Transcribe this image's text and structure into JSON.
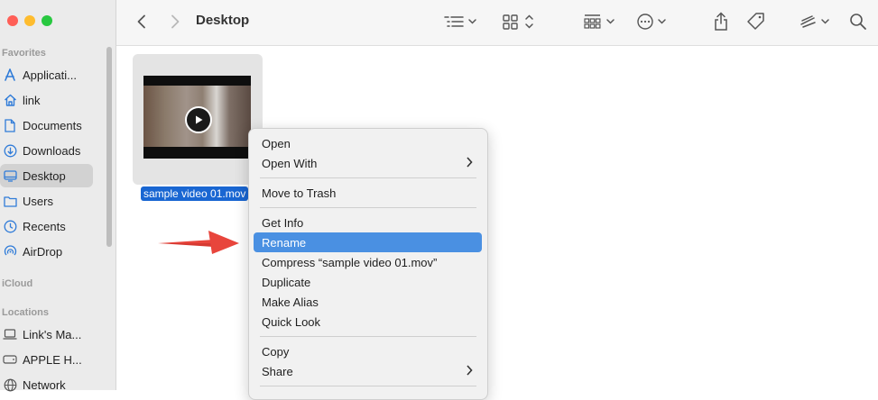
{
  "window": {
    "title": "Desktop"
  },
  "sidebar": {
    "sections": {
      "favorites": "Favorites",
      "icloud": "iCloud",
      "locations": "Locations"
    },
    "items": [
      {
        "label": "Applicati...",
        "icon": "applications-icon"
      },
      {
        "label": "link",
        "icon": "home-icon"
      },
      {
        "label": "Documents",
        "icon": "document-icon"
      },
      {
        "label": "Downloads",
        "icon": "download-icon"
      },
      {
        "label": "Desktop",
        "icon": "desktop-icon",
        "selected": true
      },
      {
        "label": "Users",
        "icon": "folder-icon"
      },
      {
        "label": "Recents",
        "icon": "clock-icon"
      },
      {
        "label": "AirDrop",
        "icon": "airdrop-icon"
      }
    ],
    "locations": [
      {
        "label": "Link's Ma...",
        "icon": "laptop-icon"
      },
      {
        "label": "APPLE H...",
        "icon": "drive-icon"
      },
      {
        "label": "Network",
        "icon": "network-icon"
      }
    ]
  },
  "file": {
    "name": "sample video 01.mov"
  },
  "context_menu": {
    "items": [
      {
        "label": "Open"
      },
      {
        "label": "Open With",
        "submenu": true
      },
      {
        "label": "Move to Trash"
      },
      {
        "label": "Get Info"
      },
      {
        "label": "Rename",
        "highlighted": true
      },
      {
        "label": "Compress “sample video 01.mov”"
      },
      {
        "label": "Duplicate"
      },
      {
        "label": "Make Alias"
      },
      {
        "label": "Quick Look"
      },
      {
        "label": "Copy"
      },
      {
        "label": "Share",
        "submenu": true
      }
    ]
  },
  "colors": {
    "highlight": "#4a90e2",
    "selection": "#1966d2",
    "annotation_arrow": "#e8453c"
  }
}
